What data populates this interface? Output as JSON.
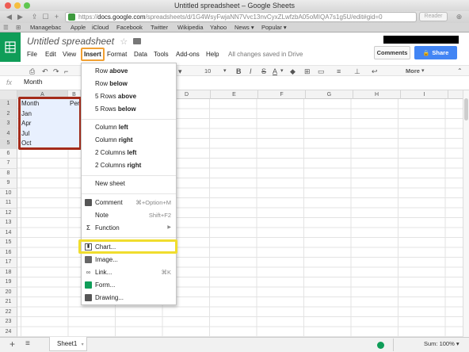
{
  "browser": {
    "window_title": "Untitled spreadsheet – Google Sheets",
    "url_prefix": "https://",
    "url_host": "docs.google.com",
    "url_rest": "/spreadsheets/d/1G4WsyFwjaNN7Vvc13nvCyxZLwfzbA05oMIQA7s1g5U/edit#gid=0",
    "reader_label": "Reader",
    "bookmarks": [
      "Managebac",
      "Apple",
      "iCloud",
      "Facebook",
      "Twitter",
      "Wikipedia",
      "Yahoo",
      "News ▾",
      "Popular ▾"
    ]
  },
  "doc": {
    "title": "Untitled spreadsheet",
    "menus": [
      "File",
      "Edit",
      "View",
      "Insert",
      "Format",
      "Data",
      "Tools",
      "Add-ons",
      "Help"
    ],
    "saved_status": "All changes saved in Drive",
    "comments_label": "Comments",
    "share_label": "Share"
  },
  "toolbar": {
    "font_size": "10",
    "more_label": "More"
  },
  "formula": {
    "fx_label": "fx",
    "value": "Month"
  },
  "grid": {
    "columns": [
      "A",
      "B",
      "C",
      "D",
      "E",
      "F",
      "G",
      "H",
      "I"
    ],
    "rows": [
      "1",
      "2",
      "3",
      "4",
      "5",
      "6",
      "7",
      "8",
      "9",
      "10",
      "11",
      "12",
      "13",
      "14",
      "15",
      "16",
      "17",
      "18",
      "19",
      "20",
      "21",
      "22",
      "23",
      "24"
    ],
    "col_a": [
      "Month",
      "Jan",
      "Apr",
      "Jul",
      "Oct"
    ],
    "col_b": [
      "Per",
      "",
      "",
      "",
      ""
    ]
  },
  "insert_menu": {
    "row_above_1": "Row ",
    "row_above_2": "above",
    "row_below_1": "Row ",
    "row_below_2": "below",
    "rows_above_1": "5 Rows ",
    "rows_above_2": "above",
    "rows_below_1": "5 Rows ",
    "rows_below_2": "below",
    "col_left_1": "Column ",
    "col_left_2": "left",
    "col_right_1": "Column ",
    "col_right_2": "right",
    "cols_left_1": "2 Columns ",
    "cols_left_2": "left",
    "cols_right_1": "2 Columns ",
    "cols_right_2": "right",
    "new_sheet": "New sheet",
    "comment": "Comment",
    "comment_shortcut": "⌘+Option+M",
    "note": "Note",
    "note_shortcut": "Shift+F2",
    "function": "Function",
    "chart": "Chart...",
    "image": "Image...",
    "link": "Link...",
    "link_shortcut": "⌘K",
    "form": "Form...",
    "drawing": "Drawing..."
  },
  "bottom": {
    "sheet_name": "Sheet1",
    "sum_label": "Sum: 100% ▾"
  },
  "colors": {
    "sheets_green": "#0f9d58",
    "share_blue": "#4285f4",
    "insert_highlight": "#f1a033",
    "selection_red": "#a42b1a",
    "chart_highlight": "#f0dd2e"
  }
}
